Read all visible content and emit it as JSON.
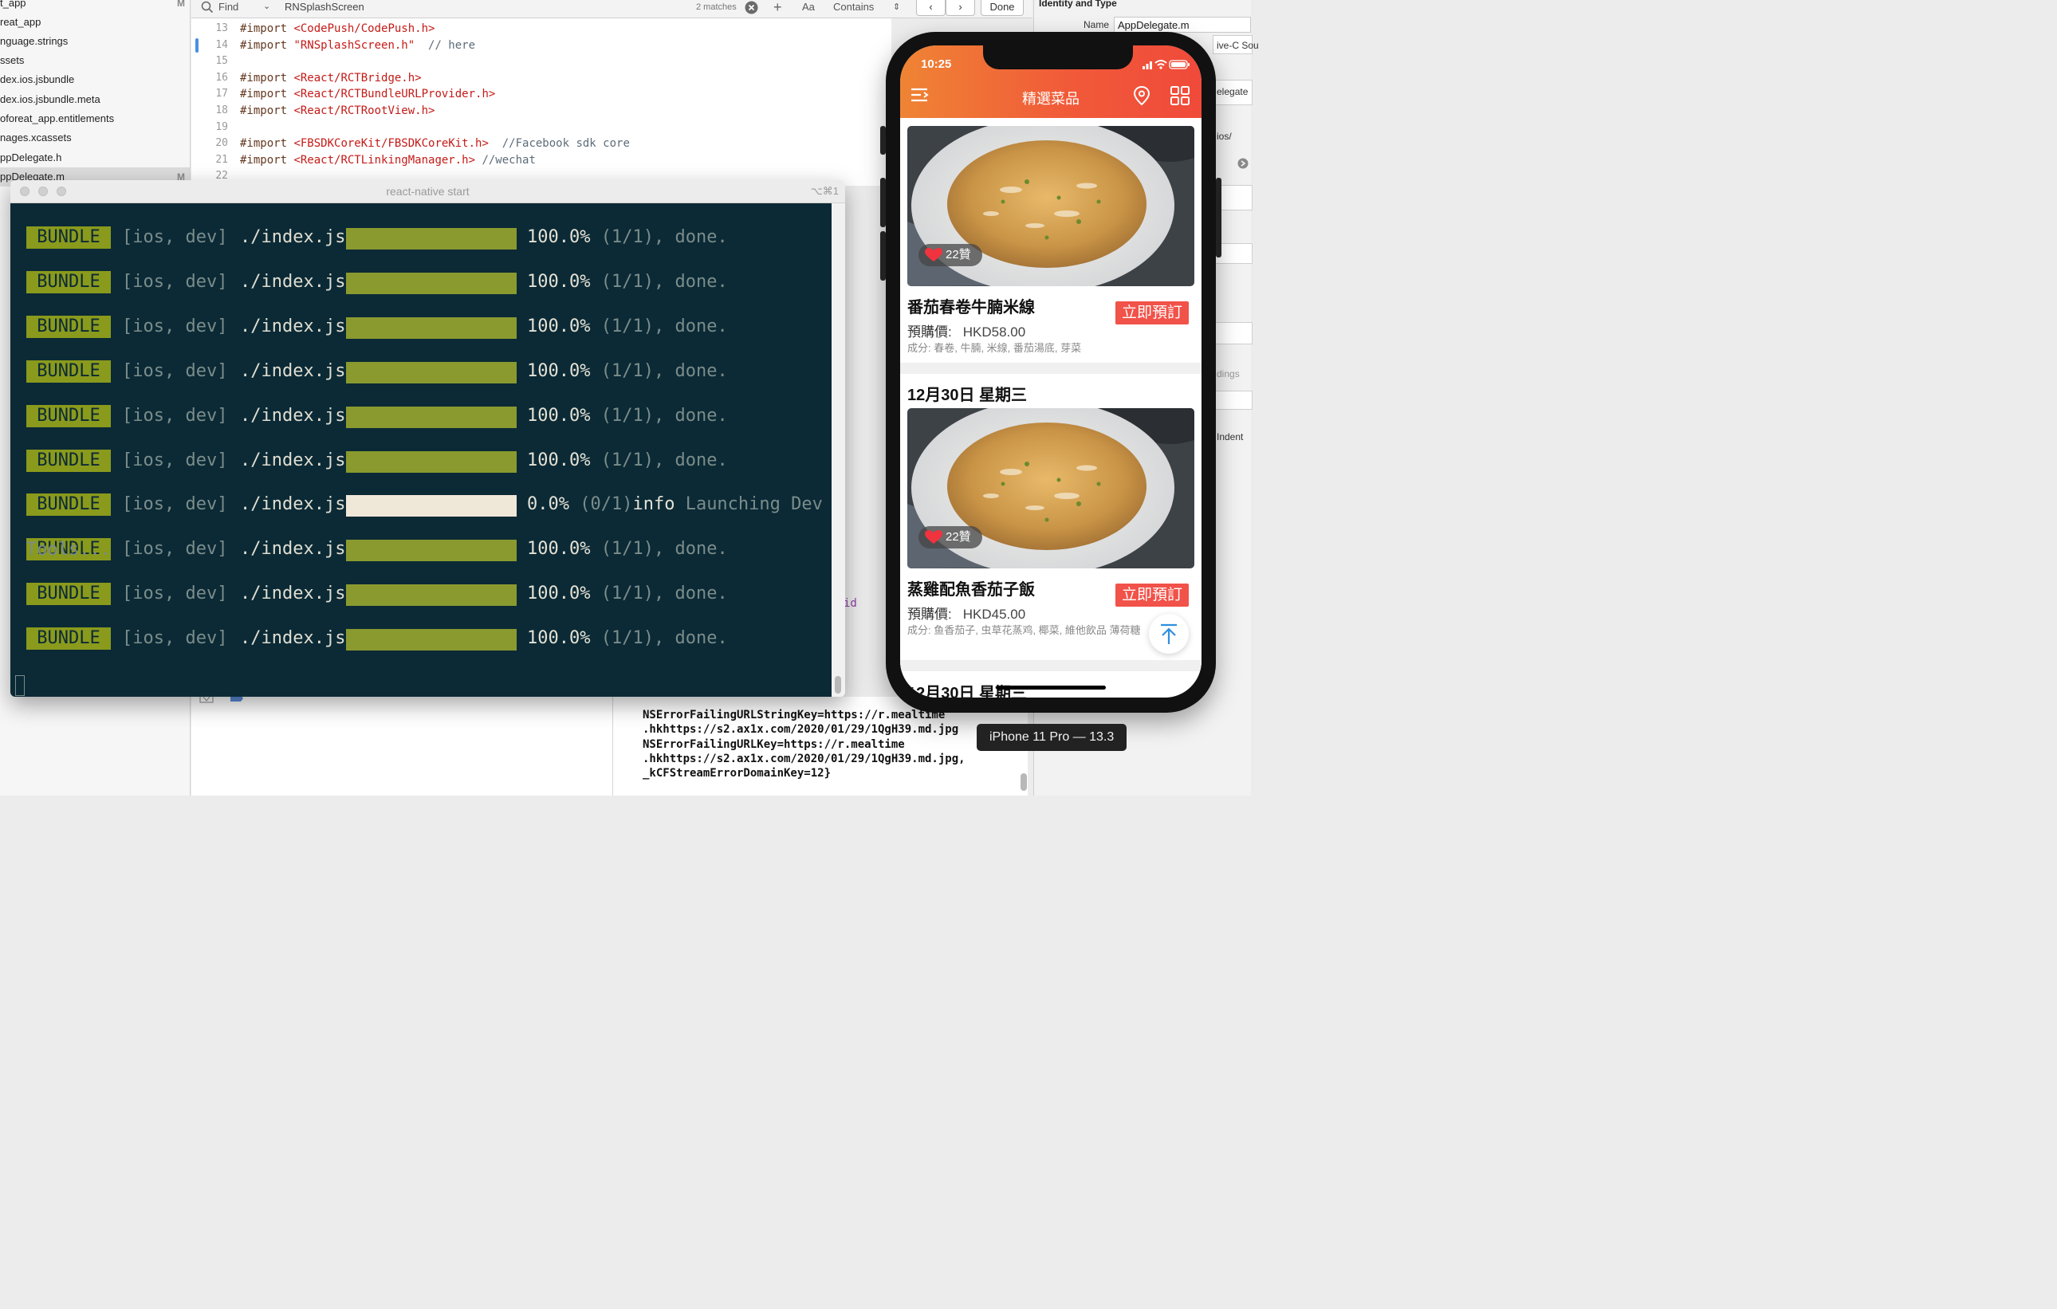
{
  "navigator": {
    "items": [
      {
        "label": "t_app",
        "badge": "M",
        "selected": false
      },
      {
        "label": "reat_app",
        "badge": "",
        "selected": false
      },
      {
        "label": "nguage.strings",
        "badge": "",
        "selected": false
      },
      {
        "label": "ssets",
        "badge": "",
        "selected": false
      },
      {
        "label": "dex.ios.jsbundle",
        "badge": "",
        "selected": false
      },
      {
        "label": "dex.ios.jsbundle.meta",
        "badge": "",
        "selected": false
      },
      {
        "label": "oforeat_app.entitlements",
        "badge": "",
        "selected": false
      },
      {
        "label": "nages.xcassets",
        "badge": "",
        "selected": false
      },
      {
        "label": "ppDelegate.h",
        "badge": "",
        "selected": false
      },
      {
        "label": "ppDelegate.m",
        "badge": "M",
        "selected": true
      }
    ]
  },
  "findbar": {
    "mode": "Find",
    "query": "RNSplashScreen",
    "matches": "2 matches",
    "case_label": "Aa",
    "match_type": "Contains",
    "done_label": "Done"
  },
  "editor": {
    "lines": [
      {
        "num": "13",
        "parts": [
          [
            "kw",
            "#import "
          ],
          [
            "str",
            "<CodePush/CodePush.h>"
          ]
        ]
      },
      {
        "num": "14",
        "parts": [
          [
            "kw",
            "#import "
          ],
          [
            "str",
            "\"RNSplashScreen.h\""
          ],
          [
            "cmt",
            "  // here"
          ]
        ]
      },
      {
        "num": "15",
        "parts": []
      },
      {
        "num": "16",
        "parts": [
          [
            "kw",
            "#import "
          ],
          [
            "str",
            "<React/RCTBridge.h>"
          ]
        ]
      },
      {
        "num": "17",
        "parts": [
          [
            "kw",
            "#import "
          ],
          [
            "str",
            "<React/RCTBundleURLProvider.h>"
          ]
        ]
      },
      {
        "num": "18",
        "parts": [
          [
            "kw",
            "#import "
          ],
          [
            "str",
            "<React/RCTRootView.h>"
          ]
        ]
      },
      {
        "num": "19",
        "parts": []
      },
      {
        "num": "20",
        "parts": [
          [
            "kw",
            "#import "
          ],
          [
            "str",
            "<FBSDKCoreKit/FBSDKCoreKit.h>"
          ],
          [
            "cmt",
            "  //Facebook sdk core"
          ]
        ]
      },
      {
        "num": "21",
        "parts": [
          [
            "kw",
            "#import "
          ],
          [
            "str",
            "<React/RCTLinkingManager.h>"
          ],
          [
            "cmt",
            " //wechat"
          ]
        ]
      },
      {
        "num": "22",
        "parts": []
      }
    ],
    "stray_token": "id"
  },
  "debug_log": "NSErrorFailingURLStringKey=https://r.mealtime\n.hkhttps://s2.ax1x.com/2020/01/29/1QgH39.md.jpg\nNSErrorFailingURLKey=https://r.mealtime\n.hkhttps://s2.ax1x.com/2020/01/29/1QgH39.md.jpg,\n_kCFStreamErrorDomainKey=12}",
  "inspector": {
    "title": "Identity and Type",
    "name_label": "Name",
    "name_value": "AppDelegate.m",
    "fragments": [
      "ive-C Sou",
      "elegate",
      "ios/",
      "dings",
      "Indent"
    ]
  },
  "terminal": {
    "title": "react-native start",
    "shortcut": "⌥⌘1",
    "rows": [
      {
        "tag": "BUNDLE",
        "platform": "[ios, dev]",
        "file": "./index.js",
        "progress": 1.0,
        "percent": "100.0%",
        "count": "(1/1),",
        "status": "done."
      },
      {
        "tag": "BUNDLE",
        "platform": "[ios, dev]",
        "file": "./index.js",
        "progress": 1.0,
        "percent": "100.0%",
        "count": "(1/1),",
        "status": "done."
      },
      {
        "tag": "BUNDLE",
        "platform": "[ios, dev]",
        "file": "./index.js",
        "progress": 1.0,
        "percent": "100.0%",
        "count": "(1/1),",
        "status": "done."
      },
      {
        "tag": "BUNDLE",
        "platform": "[ios, dev]",
        "file": "./index.js",
        "progress": 1.0,
        "percent": "100.0%",
        "count": "(1/1),",
        "status": "done."
      },
      {
        "tag": "BUNDLE",
        "platform": "[ios, dev]",
        "file": "./index.js",
        "progress": 1.0,
        "percent": "100.0%",
        "count": "(1/1),",
        "status": "done."
      },
      {
        "tag": "BUNDLE",
        "platform": "[ios, dev]",
        "file": "./index.js",
        "progress": 1.0,
        "percent": "100.0%",
        "count": "(1/1),",
        "status": "done."
      },
      {
        "tag": "BUNDLE",
        "platform": "[ios, dev]",
        "file": "./index.js",
        "progress": 0.0,
        "percent": "0.0%",
        "count": "(0/1)",
        "status": "info",
        "extra": " Launching Dev"
      },
      {
        "tag": "BUNDLE",
        "platform": "[ios, dev]",
        "file": "./index.js",
        "progress": 1.0,
        "percent": "100.0%",
        "count": "(1/1),",
        "status": "done."
      },
      {
        "tag": "BUNDLE",
        "platform": "[ios, dev]",
        "file": "./index.js",
        "progress": 1.0,
        "percent": "100.0%",
        "count": "(1/1),",
        "status": "done."
      },
      {
        "tag": "BUNDLE",
        "platform": "[ios, dev]",
        "file": "./index.js",
        "progress": 1.0,
        "percent": "100.0%",
        "count": "(1/1),",
        "status": "done."
      }
    ],
    "wrap_text": "Tools..."
  },
  "phone": {
    "time": "10:25",
    "app_title": "精選菜品",
    "cards": [
      {
        "likes": "22贊",
        "name": "番茄春卷牛腩米線",
        "price_label": "預購價:",
        "price": "HKD58.00",
        "ingredients": "成分:  春卷, 牛腩, 米線, 番茄湯底, 芽菜",
        "order": "立即預訂"
      },
      {
        "likes": "22贊",
        "name": "蒸雞配魚香茄子飯",
        "price_label": "預購價:",
        "price": "HKD45.00",
        "ingredients": "成分:  鱼香茄子, 虫草花蒸鸡, 椰菜, 維他飲品 薄荷糖",
        "order": "立即預訂"
      }
    ],
    "date_headings": [
      "12月30日 星期三",
      "12月30日 星期三"
    ],
    "device_label": "iPhone 11 Pro — 13.3"
  },
  "colors": {
    "terminal_bg": "#0b2a36",
    "bundle_tag": "#8a9a1c",
    "progress_full": "#8a9a2e",
    "progress_empty": "#efe7d8",
    "header_start": "#ef8434",
    "header_end": "#f04a3a",
    "order_button": "#f15249"
  }
}
